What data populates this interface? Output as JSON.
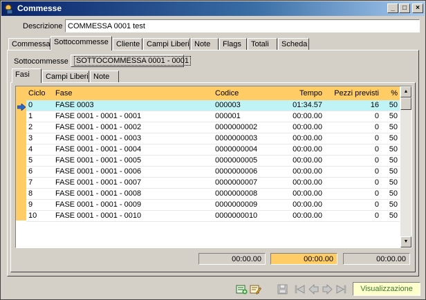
{
  "window": {
    "title": "Commesse"
  },
  "description": {
    "label": "Descrizione",
    "value": "COMMESSA 0001 test"
  },
  "main_tabs": [
    "Commessa",
    "Sottocommesse",
    "Cliente",
    "Campi Liberi",
    "Note",
    "Flags",
    "Totali",
    "Scheda"
  ],
  "sub": {
    "label": "Sottocommesse",
    "selected": "SOTTOCOMMESSA 0001 - 0001"
  },
  "inner_tabs": [
    "Fasi",
    "Campi Liberi",
    "Note"
  ],
  "grid": {
    "columns": [
      "Ciclo",
      "Fase",
      "Codice",
      "Tempo",
      "Pezzi previsti",
      "%"
    ],
    "rows": [
      [
        "0",
        "FASE 0003",
        "000003",
        "01:34.57",
        "16",
        "50"
      ],
      [
        "1",
        "FASE 0001 - 0001 - 0001",
        "000001",
        "00:00.00",
        "0",
        "50"
      ],
      [
        "2",
        "FASE 0001 - 0001 - 0002",
        "0000000002",
        "00:00.00",
        "0",
        "50"
      ],
      [
        "3",
        "FASE 0001 - 0001 - 0003",
        "0000000003",
        "00:00.00",
        "0",
        "50"
      ],
      [
        "4",
        "FASE 0001 - 0001 - 0004",
        "0000000004",
        "00:00.00",
        "0",
        "50"
      ],
      [
        "5",
        "FASE 0001 - 0001 - 0005",
        "0000000005",
        "00:00.00",
        "0",
        "50"
      ],
      [
        "6",
        "FASE 0001 - 0001 - 0006",
        "0000000006",
        "00:00.00",
        "0",
        "50"
      ],
      [
        "7",
        "FASE 0001 - 0001 - 0007",
        "0000000007",
        "00:00.00",
        "0",
        "50"
      ],
      [
        "8",
        "FASE 0001 - 0001 - 0008",
        "0000000008",
        "00:00.00",
        "0",
        "50"
      ],
      [
        "9",
        "FASE 0001 - 0001 - 0009",
        "0000000009",
        "00:00.00",
        "0",
        "50"
      ],
      [
        "10",
        "FASE 0001 - 0001 - 0010",
        "0000000010",
        "00:00.00",
        "0",
        "50"
      ]
    ]
  },
  "totals": [
    "00:00.00",
    "00:00.00",
    "00:00.00"
  ],
  "status": {
    "mode": "Visualizzazione"
  },
  "colors": {
    "header": "#ffcc66",
    "selected_row": "#bff3f5",
    "highlight_total": "#ffcc66",
    "mode_text": "#3a7a2a"
  },
  "icons": [
    "app-icon",
    "minimize-icon",
    "maximize-icon",
    "close-icon",
    "row-pointer-icon",
    "add-icon",
    "edit-icon",
    "save-icon",
    "first-icon",
    "prev-icon",
    "next-icon",
    "last-icon"
  ]
}
